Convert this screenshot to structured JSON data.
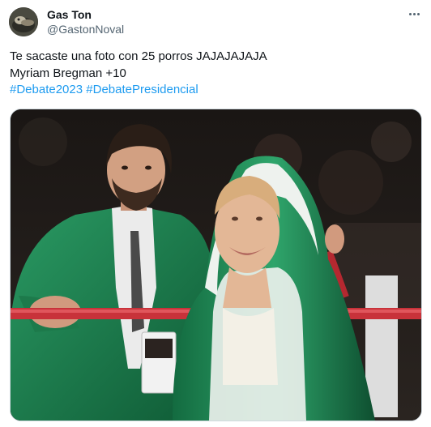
{
  "user": {
    "name": "Gas Ton",
    "handle": "@GastonNoval"
  },
  "tweet": {
    "line1": "Te sacaste una foto con 25 porros JAJAJAJAJA",
    "line2": "Myriam Bregman +10",
    "hashtags": [
      "#Debate2023",
      "#DebatePresidencial"
    ]
  },
  "icons": {
    "more": "more-options-icon",
    "avatar": "avatar"
  },
  "colors": {
    "hashtag": "#1d9bf0",
    "text": "#0f1419",
    "secondary": "#536471",
    "robe_green": "#1f7a4a",
    "ring_rope": "#c8323a"
  }
}
